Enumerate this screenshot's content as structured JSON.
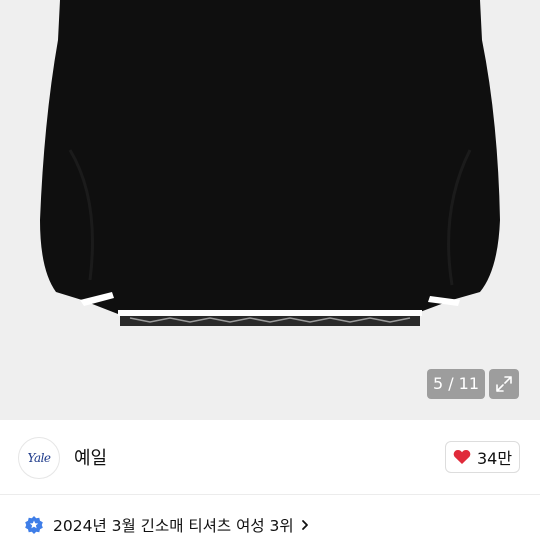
{
  "gallery": {
    "current": "5",
    "separator": "/",
    "total": "11",
    "counter_text": "5 / 11"
  },
  "seller": {
    "logo_text": "Yale",
    "name": "예일"
  },
  "likes": {
    "count": "34만"
  },
  "ranking": {
    "text": "2024년 3월 긴소매 티셔츠 여성 3위"
  },
  "colors": {
    "heart": "#e02a3a",
    "badge": "#3f7ee8",
    "sweater": "#0f0f0f"
  },
  "icons": {
    "expand": "expand-icon",
    "heart": "heart-icon",
    "rank": "star-badge-icon",
    "chevron": "chevron-right-icon"
  }
}
